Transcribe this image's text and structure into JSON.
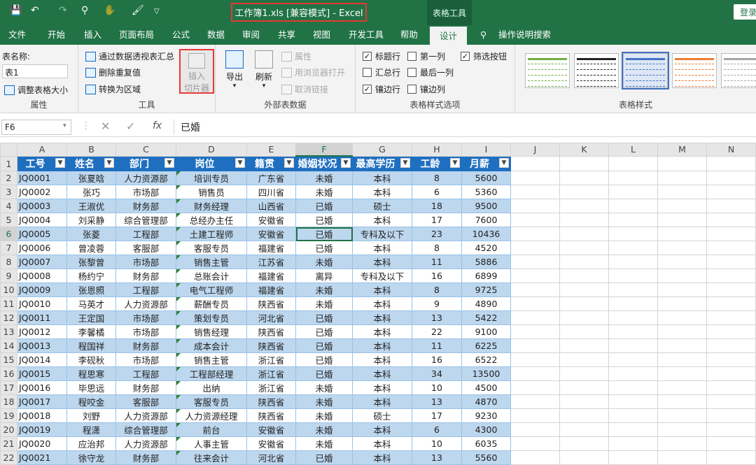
{
  "titlebar": {
    "title": "工作簿1.xls  [兼容模式]  -  Excel",
    "tools_tab": "表格工具",
    "login": "登录",
    "qa_icons": [
      "save-icon",
      "undo-icon",
      "redo-icon",
      "search-icon",
      "touch-mode-icon",
      "brush-icon",
      "customize-icon"
    ]
  },
  "menu": {
    "tabs": [
      "文件",
      "开始",
      "插入",
      "页面布局",
      "公式",
      "数据",
      "审阅",
      "共享",
      "视图",
      "开发工具",
      "帮助",
      "设计"
    ],
    "active_tab": "设计",
    "tell_me": "操作说明搜索"
  },
  "ribbon": {
    "properties": {
      "table_name_label": "表名称:",
      "table_name_value": "表1",
      "resize": "调整表格大小",
      "group": "属性"
    },
    "tools": {
      "pivot": "通过数据透视表汇总",
      "remove_dup": "删除重复值",
      "to_range": "转换为区域",
      "slicer": "插入\n切片器",
      "slicer_l1": "插入",
      "slicer_l2": "切片器",
      "group": "工具"
    },
    "external": {
      "export": "导出",
      "refresh": "刷新",
      "properties": "属性",
      "open_browser": "用浏览器打开",
      "unlink": "取消链接",
      "group": "外部表数据"
    },
    "style_options": {
      "header_row": "标题行",
      "first_col": "第一列",
      "filter_btn": "筛选按钮",
      "total_row": "汇总行",
      "last_col": "最后一列",
      "banded_rows": "镶边行",
      "banded_cols": "镶边列",
      "group": "表格样式选项"
    },
    "styles": {
      "group": "表格样式",
      "colors": [
        "#70ad47",
        "#222222",
        "#4472c4",
        "#ed7d31",
        "#a5a5a5"
      ]
    }
  },
  "formula": {
    "cell": "F6",
    "value": "已婚"
  },
  "sheet": {
    "columns": [
      "A",
      "B",
      "C",
      "D",
      "E",
      "F",
      "G",
      "H",
      "I",
      "J",
      "K",
      "L",
      "M",
      "N"
    ],
    "headers": [
      "工号",
      "姓名",
      "部门",
      "岗位",
      "籍贯",
      "婚姻状况",
      "最高学历",
      "工龄",
      "月薪"
    ],
    "rows": [
      [
        "JQ0001",
        "张夏晗",
        "人力资源部",
        "培训专员",
        "广东省",
        "未婚",
        "本科",
        "8",
        "5600"
      ],
      [
        "JQ0002",
        "张巧",
        "市场部",
        "销售员",
        "四川省",
        "未婚",
        "本科",
        "6",
        "5360"
      ],
      [
        "JQ0003",
        "王淑优",
        "财务部",
        "财务经理",
        "山西省",
        "已婚",
        "硕士",
        "18",
        "9500"
      ],
      [
        "JQ0004",
        "刘采静",
        "综合管理部",
        "总经办主任",
        "安徽省",
        "已婚",
        "本科",
        "17",
        "7600"
      ],
      [
        "JQ0005",
        "张菱",
        "工程部",
        "土建工程师",
        "安徽省",
        "已婚",
        "专科及以下",
        "23",
        "10436"
      ],
      [
        "JQ0006",
        "曾凌蓉",
        "客服部",
        "客服专员",
        "福建省",
        "已婚",
        "本科",
        "8",
        "4520"
      ],
      [
        "JQ0007",
        "张黎曾",
        "市场部",
        "销售主管",
        "江苏省",
        "未婚",
        "本科",
        "11",
        "5886"
      ],
      [
        "JQ0008",
        "杨约宁",
        "财务部",
        "总账会计",
        "福建省",
        "离异",
        "专科及以下",
        "16",
        "6899"
      ],
      [
        "JQ0009",
        "张恩照",
        "工程部",
        "电气工程师",
        "福建省",
        "未婚",
        "本科",
        "8",
        "9725"
      ],
      [
        "JQ0010",
        "马英才",
        "人力资源部",
        "薪酬专员",
        "陕西省",
        "未婚",
        "本科",
        "9",
        "4890"
      ],
      [
        "JQ0011",
        "王定国",
        "市场部",
        "策划专员",
        "河北省",
        "已婚",
        "本科",
        "13",
        "5422"
      ],
      [
        "JQ0012",
        "李馨橘",
        "市场部",
        "销售经理",
        "陕西省",
        "已婚",
        "本科",
        "22",
        "9100"
      ],
      [
        "JQ0013",
        "程国祥",
        "财务部",
        "成本会计",
        "陕西省",
        "已婚",
        "本科",
        "11",
        "6225"
      ],
      [
        "JQ0014",
        "李砚秋",
        "市场部",
        "销售主管",
        "浙江省",
        "已婚",
        "本科",
        "16",
        "6522"
      ],
      [
        "JQ0015",
        "程思寒",
        "工程部",
        "工程部经理",
        "浙江省",
        "已婚",
        "本科",
        "34",
        "13500"
      ],
      [
        "JQ0016",
        "毕思远",
        "财务部",
        "出纳",
        "浙江省",
        "未婚",
        "本科",
        "10",
        "4500"
      ],
      [
        "JQ0017",
        "程咬金",
        "客服部",
        "客服专员",
        "陕西省",
        "未婚",
        "本科",
        "13",
        "4870"
      ],
      [
        "JQ0018",
        "刘野",
        "人力资源部",
        "人力资源经理",
        "陕西省",
        "未婚",
        "硕士",
        "17",
        "9230"
      ],
      [
        "JQ0019",
        "程潇",
        "综合管理部",
        "前台",
        "安徽省",
        "未婚",
        "本科",
        "6",
        "4300"
      ],
      [
        "JQ0020",
        "应治邦",
        "人力资源部",
        "人事主管",
        "安徽省",
        "未婚",
        "本科",
        "10",
        "6035"
      ],
      [
        "JQ0021",
        "徐守龙",
        "财务部",
        "往来会计",
        "河北省",
        "已婚",
        "本科",
        "13",
        "5560"
      ]
    ]
  }
}
